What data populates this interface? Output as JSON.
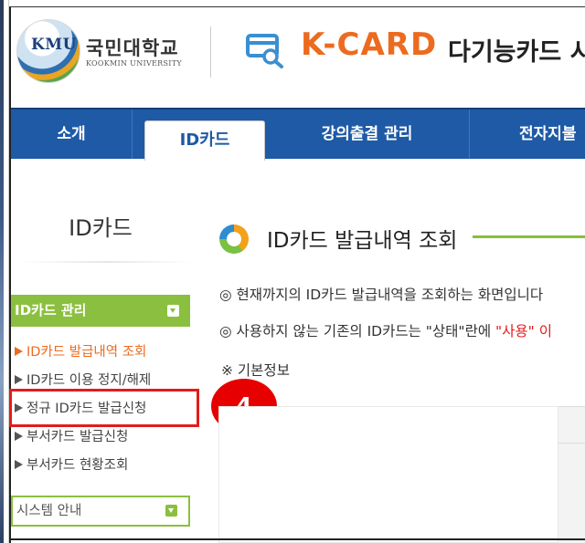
{
  "header": {
    "logo_abbr": "KMU",
    "university_ko": "국민대학교",
    "university_en": "KOOKMIN UNIVERSITY",
    "service_title": "K-CARD",
    "service_subtitle": "다기능카드 시"
  },
  "nav": {
    "items": [
      {
        "label": "소개"
      },
      {
        "label": "ID카드"
      },
      {
        "label": "강의출결 관리"
      },
      {
        "label": "전자지불"
      }
    ]
  },
  "sidebar": {
    "title": "ID카드",
    "menu_head": "ID카드 관리",
    "items": [
      {
        "label": "ID카드 발급내역 조회"
      },
      {
        "label": "ID카드 이용 정지/해제"
      },
      {
        "label": "정규 ID카드 발급신청"
      },
      {
        "label": "부서카드 발급신청"
      },
      {
        "label": "부서카드 현황조회"
      }
    ],
    "system_head": "시스템 안내"
  },
  "annotation": {
    "step": "4"
  },
  "main": {
    "title": "ID카드 발급내역 조회",
    "info1": "◎  현재까지의 ID카드 발급내역을 조회하는 화면입니다",
    "info2_pre": "◎  사용하지 않는 기존의 ID카드는 \"상태\"란에 ",
    "info2_red": "\"사용\" 이",
    "section": "※ 기본정보"
  },
  "colors": {
    "nav_blue": "#1e5aa6",
    "accent_green": "#8bbf3f",
    "accent_orange": "#ec6b1f",
    "highlight_red": "#e41b1b"
  }
}
